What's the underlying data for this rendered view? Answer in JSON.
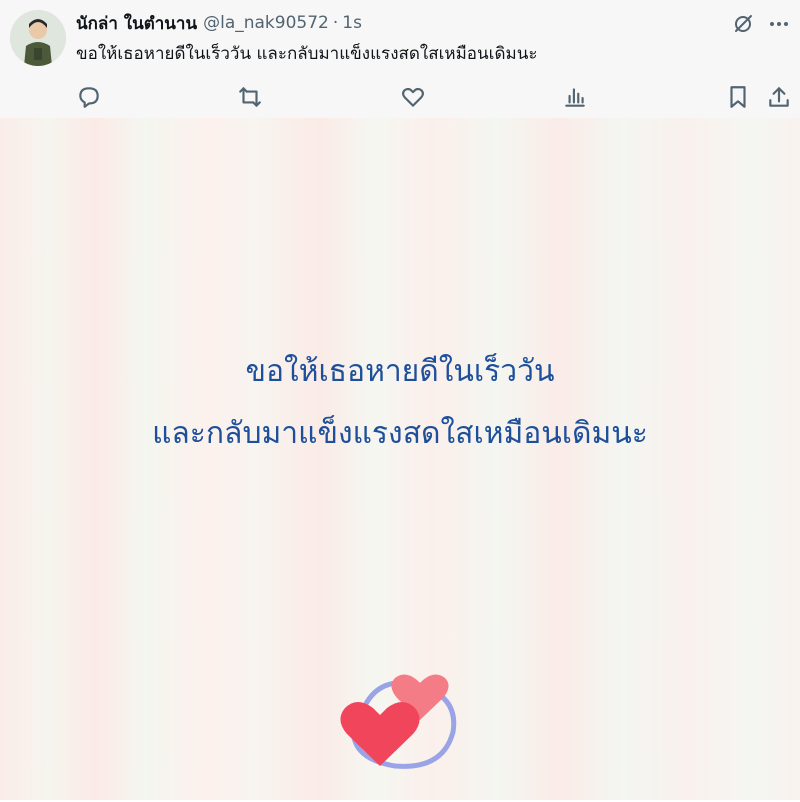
{
  "post": {
    "display_name": "นักล่า ในตำนาน",
    "handle": "@la_nak90572",
    "separator": "·",
    "timestamp": "1s",
    "text": "ขอให้เธอหายดีในเร็ววัน และกลับมาแข็งแรงสดใสเหมือนเดิมนะ"
  },
  "icons": {
    "top": [
      "grok-icon",
      "more-icon"
    ],
    "actions": [
      "reply-icon",
      "repost-icon",
      "like-icon",
      "views-icon",
      "bookmark-icon",
      "share-icon"
    ]
  },
  "media": {
    "line1": "ขอให้เธอหายดีในเร็ววัน",
    "line2": "และกลับมาแข็งแรงสดใสเหมือนเดิมนะ",
    "text_color": "#1d4f9a"
  },
  "colors": {
    "heart_front": "#f0455a",
    "heart_back": "#f47c86",
    "swirl": "#9aa3e6"
  }
}
